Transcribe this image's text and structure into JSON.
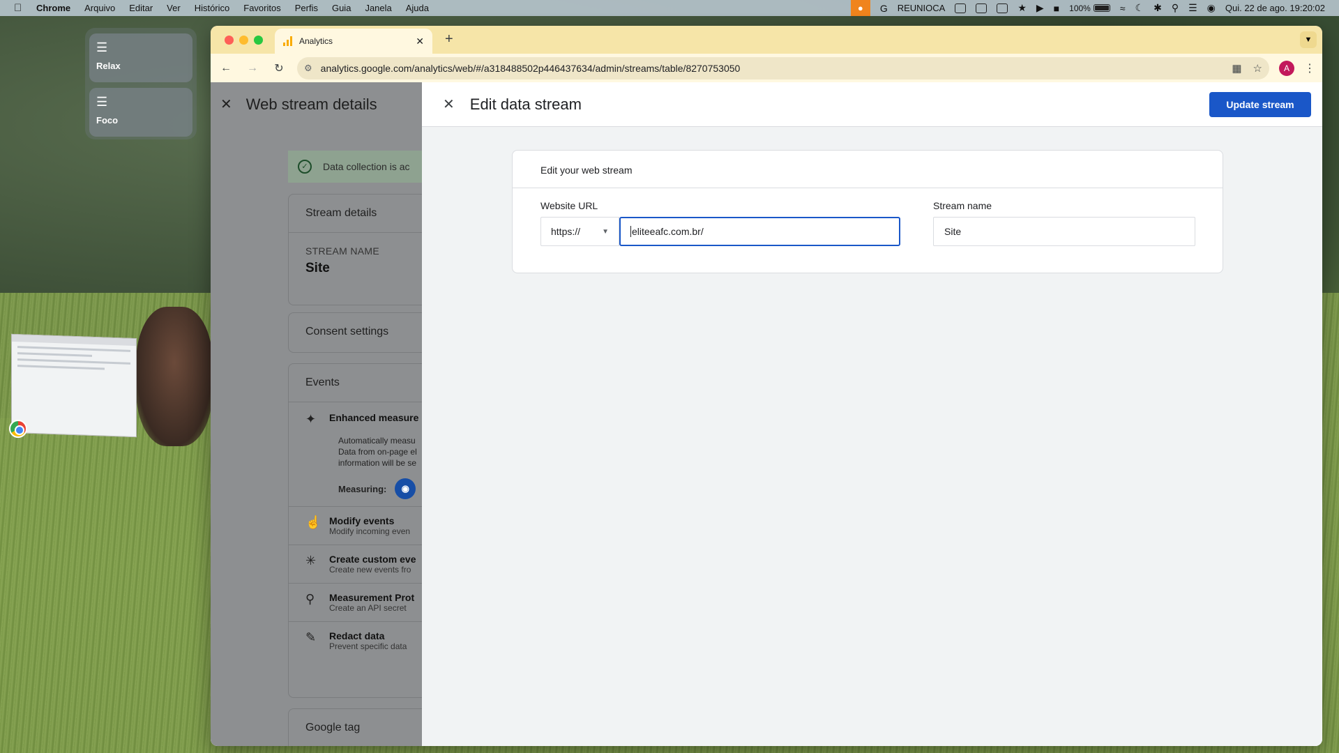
{
  "menubar": {
    "app_name": "Chrome",
    "menus": [
      "Arquivo",
      "Editar",
      "Ver",
      "Histórico",
      "Favoritos",
      "Perfis",
      "Guia",
      "Janela",
      "Ajuda"
    ],
    "status_text": "REUNIOCA",
    "battery_percent": "100%",
    "datetime": "Qui. 22 de ago.  19:20:02"
  },
  "focus_modes": [
    {
      "label": "Relax",
      "icon": "layers-icon"
    },
    {
      "label": "Foco",
      "icon": "layers-icon"
    }
  ],
  "browser": {
    "tab_title": "Analytics",
    "url": "analytics.google.com/analytics/web/#/a318488502p446437634/admin/streams/table/8270753050",
    "profile_initial": "A"
  },
  "left_panel": {
    "title": "Web stream details",
    "banner_text": "Data collection is ac",
    "stream_details_heading": "Stream details",
    "stream_name_label": "STREAM NAME",
    "stream_name_value": "Site",
    "consent_heading": "Consent settings",
    "events_heading": "Events",
    "enhanced_title": "Enhanced measure",
    "enhanced_desc": [
      "Automatically measu",
      "Data from on-page el",
      "information will be se"
    ],
    "measuring_label": "Measuring:",
    "event_rows": [
      {
        "title": "Modify events",
        "sub": "Modify incoming even",
        "icon": "touch-icon"
      },
      {
        "title": "Create custom eve",
        "sub": "Create new events fro",
        "icon": "sparkle-cursor-icon"
      },
      {
        "title": "Measurement Prot",
        "sub": "Create an API secret",
        "icon": "key-icon"
      },
      {
        "title": "Redact data",
        "sub": "Prevent specific data",
        "icon": "eraser-icon"
      }
    ],
    "google_tag_heading": "Google tag"
  },
  "edit_panel": {
    "title": "Edit data stream",
    "update_button": "Update stream",
    "card_title": "Edit your web stream",
    "website_url_label": "Website URL",
    "protocol": "https://",
    "url_value": "eliteeafc.com.br/",
    "stream_name_label": "Stream name",
    "stream_name_value": "Site"
  },
  "colors": {
    "primary_button": "#1a57c8",
    "tab_strip": "#f6e5a8",
    "focus_outline": "#1a57c8"
  }
}
